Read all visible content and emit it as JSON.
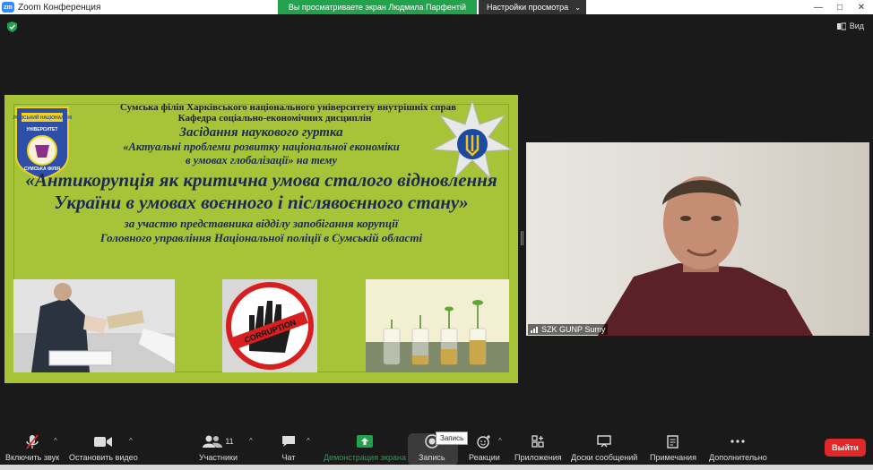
{
  "window": {
    "title": "Zoom Конференция",
    "share_banner": "Вы просматриваете экран Людмила Парфентій",
    "view_settings": "Настройки просмотра",
    "view_button": "Вид"
  },
  "slide": {
    "line1": "Сумська філія Харківського національного університету внутрішніх справ",
    "line2": "Кафедра соціально-економічних дисциплін",
    "line3": "Засідання наукового гуртка",
    "line4": "«Актуальні проблеми розвитку національної економіки",
    "line5": "в умовах глобалізації» на тему",
    "line6": "«Антикорупція як критична умова сталого відновлення",
    "line7": "України в умовах воєнного і післявоєнного стану»",
    "line8": "за участю представника відділу запобігання корупції",
    "line9": "Головного управління Національної поліції в Сумській області",
    "emblem_text_top": "ХАРКІВСЬКИЙ НАЦІОНАЛЬНИЙ",
    "emblem_text_mid": "УНІВЕРСИТЕТ",
    "emblem_text_bottom": "СУМСЬКА ФІЛІЯ",
    "corruption_label": "CORRUPTION"
  },
  "participant": {
    "name": "SZK GUNP Sumy"
  },
  "toolbar": {
    "mute_label": "Включить звук",
    "video_label": "Остановить видео",
    "participants_label": "Участники",
    "participants_count": "11",
    "chat_label": "Чат",
    "share_label": "Демонстрация экрана",
    "record_label": "Запись",
    "record_tooltip": "Запись",
    "reactions_label": "Реакции",
    "apps_label": "Приложения",
    "whiteboard_label": "Доски сообщений",
    "notes_label": "Примечания",
    "more_label": "Дополнительно",
    "leave_label": "Выйти"
  },
  "colors": {
    "slide_bg": "#a7c338",
    "share_banner": "#23a24d",
    "leave": "#e02828",
    "share_icon": "#23a24d"
  }
}
